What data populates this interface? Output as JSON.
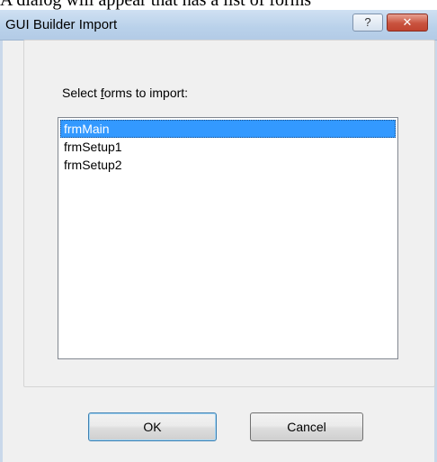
{
  "doc_caption": "A dialog will appear that has a list of forms",
  "window": {
    "title": "GUI Builder Import",
    "help_label": "?",
    "close_label": "✕"
  },
  "dialog": {
    "select_label_pre": "Select ",
    "select_label_accel": "f",
    "select_label_post": "orms to import:",
    "forms": [
      {
        "name": "frmMain",
        "selected": true
      },
      {
        "name": "frmSetup1",
        "selected": false
      },
      {
        "name": "frmSetup2",
        "selected": false
      }
    ],
    "ok_label": "OK",
    "cancel_label": "Cancel"
  },
  "colors": {
    "selection": "#3399ff",
    "close_button": "#c9533f",
    "titlebar": "#b9d1ea"
  }
}
